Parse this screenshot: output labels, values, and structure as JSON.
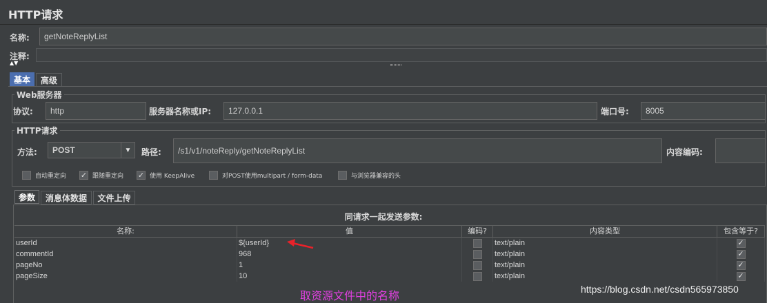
{
  "window": {
    "title": "HTTP请求"
  },
  "name_field": {
    "label": "名称:",
    "value": "getNoteReplyList"
  },
  "comment_field": {
    "label": "注释:"
  },
  "main_tabs": [
    {
      "label": "基本"
    },
    {
      "label": "高级"
    }
  ],
  "web_server": {
    "group_title": "Web服务器",
    "protocol_label": "协议:",
    "protocol_value": "http",
    "server_label": "服务器名称或IP:",
    "server_value": "127.0.0.1",
    "port_label": "端口号:",
    "port_value": "8005"
  },
  "http_request": {
    "group_title": "HTTP请求",
    "method_label": "方法:",
    "method_value": "POST",
    "path_label": "路径:",
    "path_value": "/s1/v1/noteReply/getNoteReplyList",
    "encoding_label": "内容编码:",
    "encoding_value": ""
  },
  "options": [
    {
      "label": "自动重定向",
      "checked": false
    },
    {
      "label": "跟随重定向",
      "checked": true
    },
    {
      "label": "使用 KeepAlive",
      "checked": true
    },
    {
      "label": "对POST使用multipart / form-data",
      "checked": false
    },
    {
      "label": "与浏览器兼容的头",
      "checked": false
    }
  ],
  "sub_tabs": [
    {
      "label": "参数"
    },
    {
      "label": "消息体数据"
    },
    {
      "label": "文件上传"
    }
  ],
  "params": {
    "caption": "同请求一起发送参数:",
    "columns": [
      "名称:",
      "值",
      "编码?",
      "内容类型",
      "包含等于?"
    ],
    "rows": [
      {
        "name": "userId",
        "value": "${userId}",
        "encode": false,
        "content_type": "text/plain",
        "include_equals": true
      },
      {
        "name": "commentId",
        "value": "968",
        "encode": false,
        "content_type": "text/plain",
        "include_equals": true
      },
      {
        "name": "pageNo",
        "value": "1",
        "encode": false,
        "content_type": "text/plain",
        "include_equals": true
      },
      {
        "name": "pageSize",
        "value": "10",
        "encode": false,
        "content_type": "text/plain",
        "include_equals": true
      }
    ]
  },
  "annotation": {
    "text": "取资源文件中的名称",
    "arrow_color": "#e8222a",
    "text_color": "#e040e0"
  },
  "watermark": "https://blog.csdn.net/csdn565973850"
}
